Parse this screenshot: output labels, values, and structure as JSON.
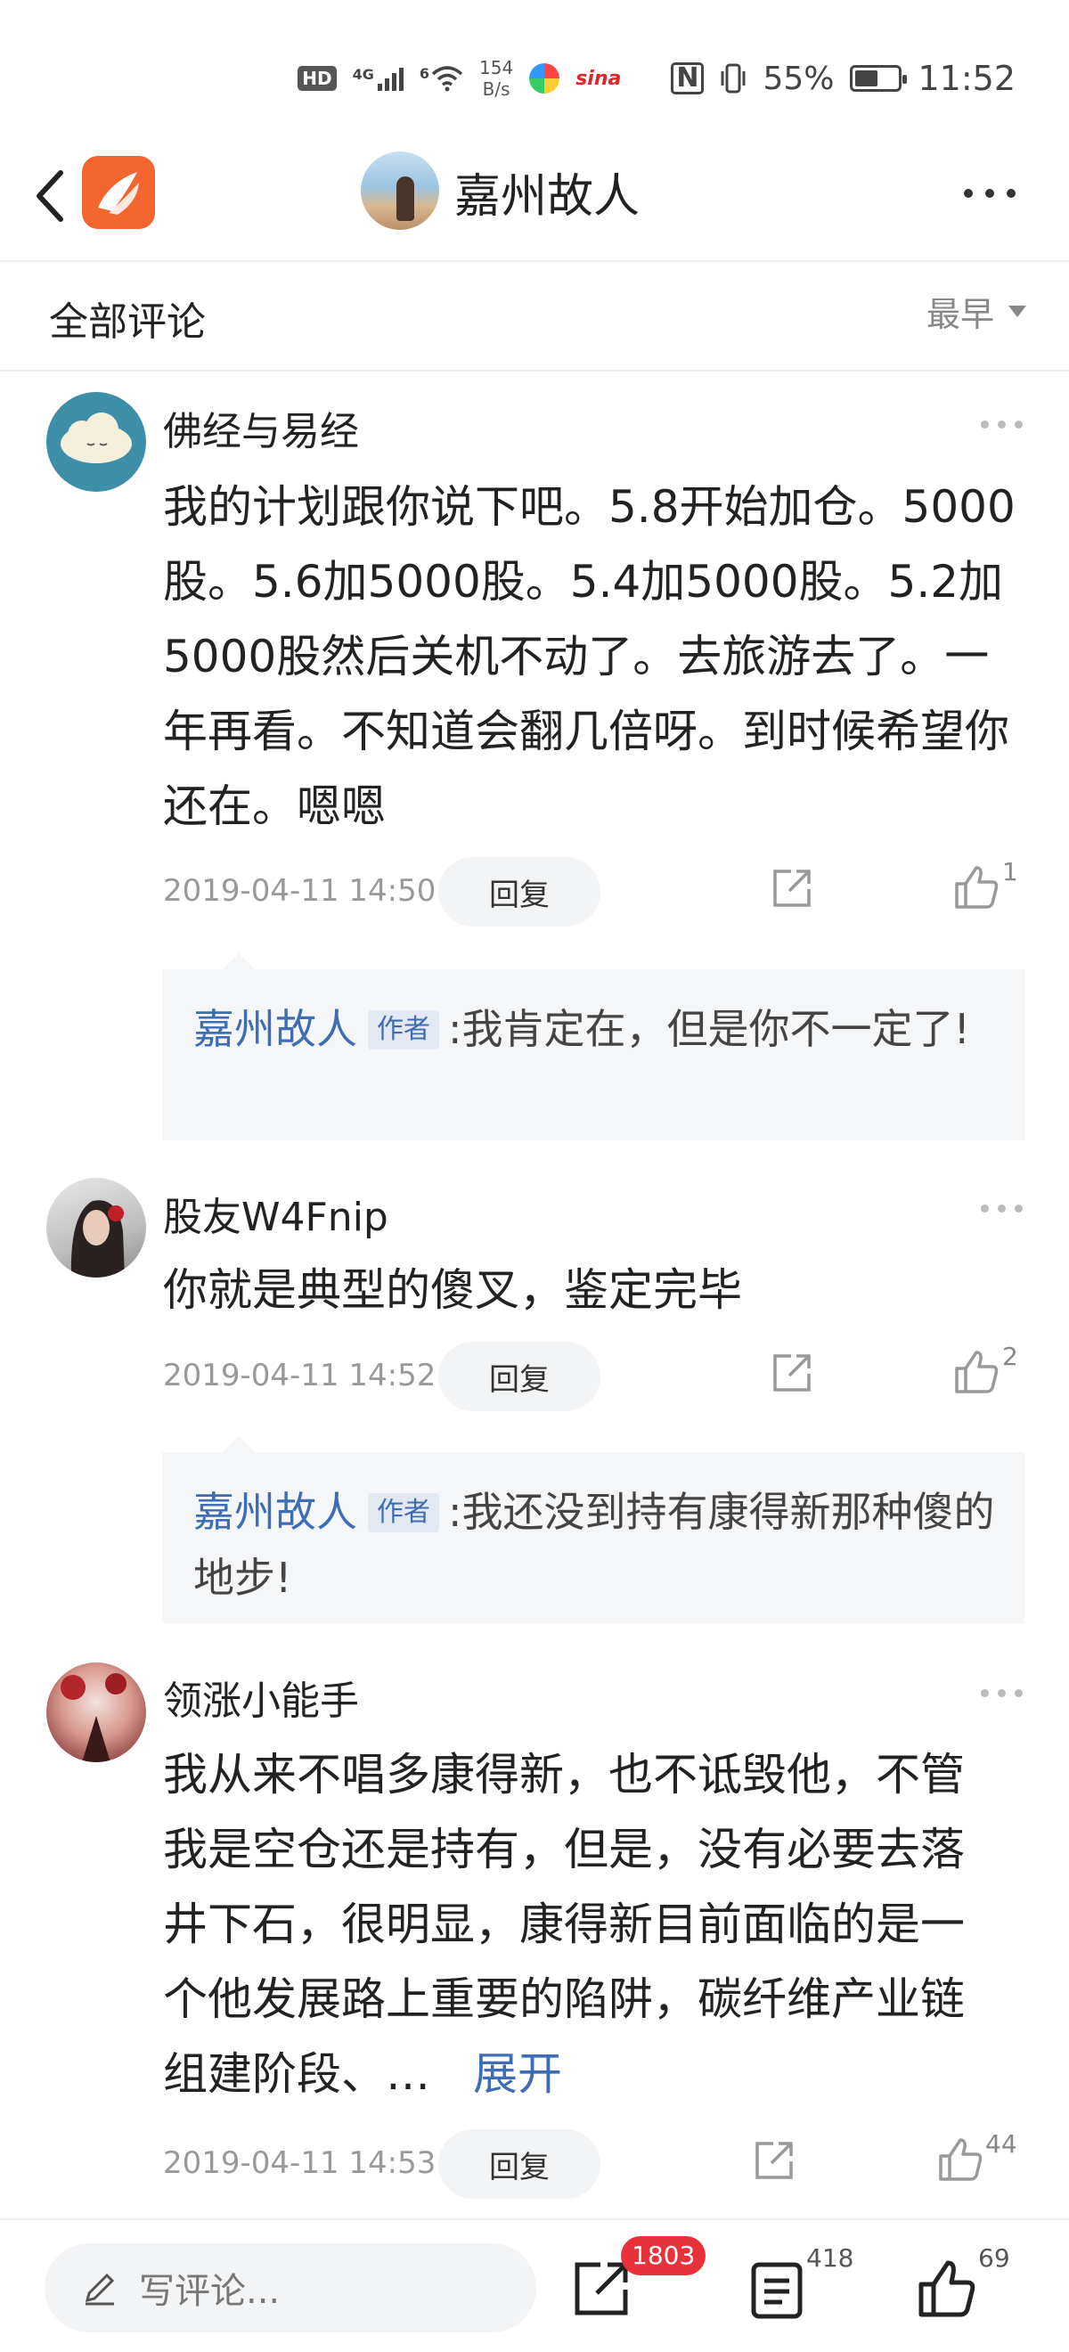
{
  "status_bar": {
    "hd": "HD",
    "network": "4G",
    "wifi": "6",
    "speed_value": "154",
    "speed_unit": "B/s",
    "nfc": "N",
    "battery_pct": "55%",
    "battery_level": 0.55,
    "time": "11:52"
  },
  "header": {
    "title": "嘉州故人",
    "logo_color": "#f2652e"
  },
  "comments_header": {
    "title": "全部评论",
    "sort_label": "最早"
  },
  "comments": [
    {
      "user": "佛经与易经",
      "text": "我的计划跟你说下吧。5.8开始加仓。5000股。5.6加5000股。5.4加5000股。5.2加5000股然后关机不动了。去旅游去了。一年再看。不知道会翻几倍呀。到时候希望你还在。嗯嗯",
      "time": "2019-04-11 14:50",
      "reply_label": "回复",
      "likes": "1",
      "reply": {
        "author": "嘉州故人",
        "tag": "作者",
        "text": ":我肯定在，但是你不一定了!"
      }
    },
    {
      "user": "股友W4Fnip",
      "text": "你就是典型的傻叉，鉴定完毕",
      "time": "2019-04-11 14:52",
      "reply_label": "回复",
      "likes": "2",
      "reply": {
        "author": "嘉州故人",
        "tag": "作者",
        "text": ":我还没到持有康得新那种傻的地步!"
      }
    },
    {
      "user": "领涨小能手",
      "text": "我从来不唱多康得新，也不诋毁他，不管我是空仓还是持有，但是，没有必要去落井下石，很明显，康得新目前面临的是一个他发展路上重要的陷阱，碳纤维产业链组建阶段、…",
      "expand_label": "展开",
      "time": "2019-04-11 14:53",
      "reply_label": "回复",
      "likes": "44"
    }
  ],
  "bottom_bar": {
    "input_placeholder": "写评论...",
    "share_count": "1803",
    "comment_count": "418",
    "like_count": "69"
  }
}
